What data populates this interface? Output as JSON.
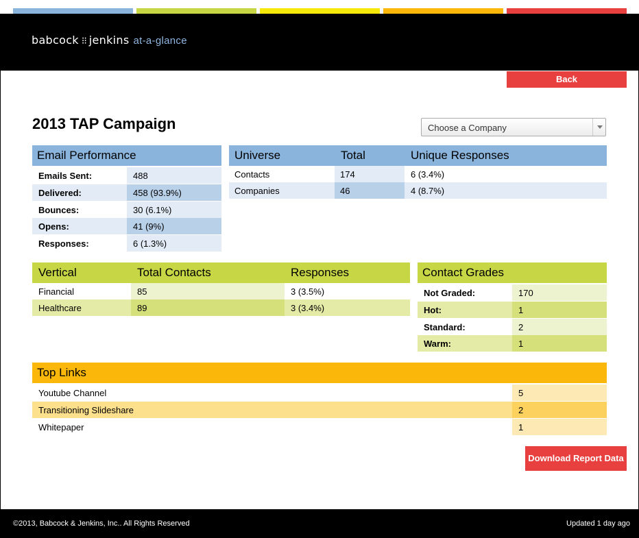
{
  "colors": {
    "blue": "#8bb4dc",
    "green": "#c6d645",
    "yellow": "#f7e70a",
    "orange": "#fbb80b",
    "red": "#e8403f"
  },
  "header": {
    "brand_left": "babcock",
    "brand_right": "jenkins",
    "tagline": "at-a-glance"
  },
  "back_label": "Back",
  "page_title": "2013 TAP Campaign",
  "company_select": {
    "value": "Choose a Company"
  },
  "email_performance": {
    "title": "Email Performance",
    "rows": [
      {
        "label": "Emails Sent:",
        "value": "488"
      },
      {
        "label": "Delivered:",
        "value": "458 (93.9%)"
      },
      {
        "label": "Bounces:",
        "value": "30 (6.1%)"
      },
      {
        "label": "Opens:",
        "value": "41 (9%)"
      },
      {
        "label": "Responses:",
        "value": "6 (1.3%)"
      }
    ]
  },
  "universe": {
    "headers": [
      "Universe",
      "Total",
      "Unique Responses"
    ],
    "rows": [
      {
        "name": "Contacts",
        "total": "174",
        "unique": "6 (3.4%)"
      },
      {
        "name": "Companies",
        "total": "46",
        "unique": "4 (8.7%)"
      }
    ]
  },
  "vertical": {
    "headers": [
      "Vertical",
      "Total Contacts",
      "Responses"
    ],
    "rows": [
      {
        "name": "Financial",
        "total": "85",
        "responses": "3 (3.5%)"
      },
      {
        "name": "Healthcare",
        "total": "89",
        "responses": "3 (3.4%)"
      }
    ]
  },
  "contact_grades": {
    "title": "Contact Grades",
    "rows": [
      {
        "label": "Not Graded:",
        "value": "170"
      },
      {
        "label": "Hot:",
        "value": "1"
      },
      {
        "label": "Standard:",
        "value": "2"
      },
      {
        "label": "Warm:",
        "value": "1"
      }
    ]
  },
  "top_links": {
    "title": "Top Links",
    "rows": [
      {
        "name": "Youtube Channel",
        "count": "5"
      },
      {
        "name": "Transitioning Slideshare",
        "count": "2"
      },
      {
        "name": "Whitepaper",
        "count": "1"
      }
    ]
  },
  "download_label": "Download Report Data",
  "footer": {
    "copyright": "©2013, Babcock & Jenkins, Inc.. All Rights Reserved",
    "updated": "Updated 1 day ago"
  }
}
